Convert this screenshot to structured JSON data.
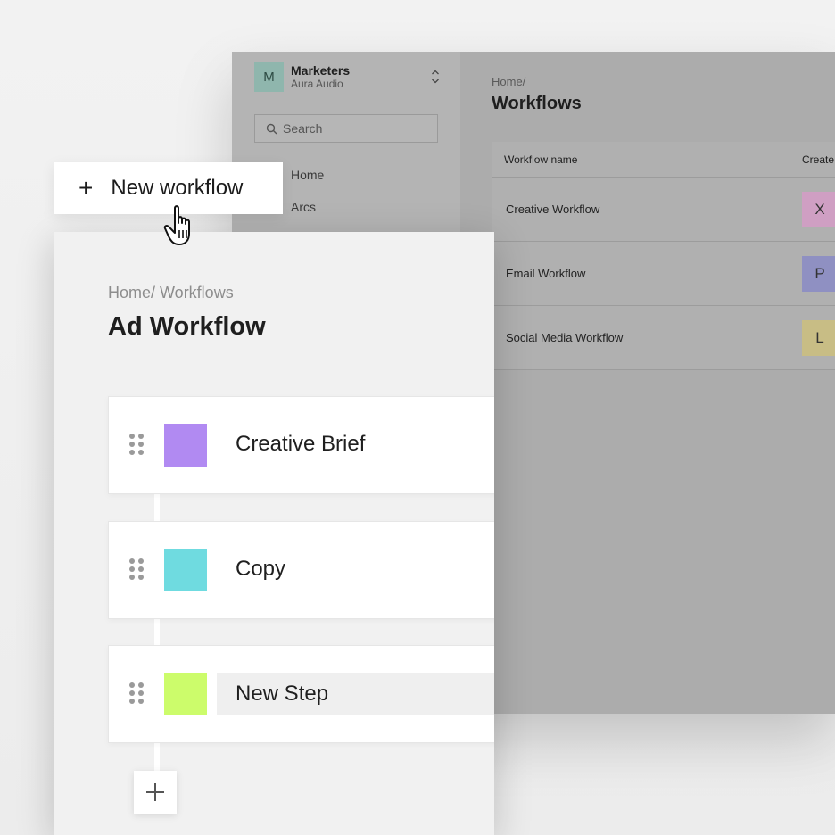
{
  "background_app": {
    "org": {
      "initial": "M",
      "name": "Marketers",
      "subtitle": "Aura Audio"
    },
    "search_placeholder": "Search",
    "nav": [
      {
        "label": "Home"
      },
      {
        "label": "Arcs"
      }
    ],
    "breadcrumb": "Home/",
    "title": "Workflows",
    "table": {
      "columns": [
        "Workflow name",
        "Create"
      ],
      "rows": [
        {
          "name": "Creative Workflow",
          "creator": "X",
          "creator_color": "#cf9fc3"
        },
        {
          "name": "Email Workflow",
          "creator": "P",
          "creator_color": "#8f90c2"
        },
        {
          "name": "Social Media Workflow",
          "creator": "L",
          "creator_color": "#c8bd85"
        }
      ]
    }
  },
  "new_workflow_button": {
    "icon": "plus-icon",
    "label": "New workflow"
  },
  "editor": {
    "breadcrumb": "Home/ Workflows",
    "title": "Ad Workflow",
    "steps": [
      {
        "label": "Creative Brief",
        "color": "#b18af2"
      },
      {
        "label": "Copy",
        "color": "#6fdbe0"
      },
      {
        "label": "New Step",
        "color": "#ccfc6b",
        "editing": true
      }
    ],
    "add_step_icon": "plus-icon"
  }
}
